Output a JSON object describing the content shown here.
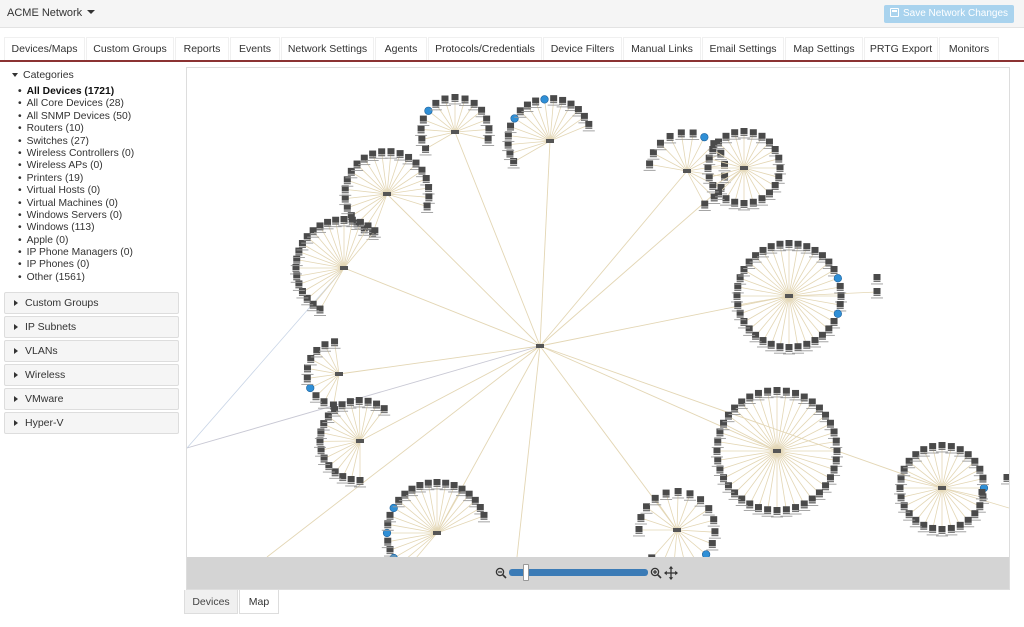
{
  "header": {
    "network_name": "ACME Network",
    "save_label": "Save Network Changes"
  },
  "tabs": [
    {
      "label": "Devices/Maps",
      "style": "active"
    },
    {
      "label": "Custom Groups",
      "style": "pink"
    },
    {
      "label": "Reports",
      "style": "pink"
    },
    {
      "label": "Events",
      "style": "pink"
    },
    {
      "label": "Network Settings",
      "style": "teal"
    },
    {
      "label": "Agents",
      "style": "teal"
    },
    {
      "label": "Protocols/Credentials",
      "style": "teal"
    },
    {
      "label": "Device Filters",
      "style": "teal"
    },
    {
      "label": "Manual Links",
      "style": "teal"
    },
    {
      "label": "Email Settings",
      "style": "teal"
    },
    {
      "label": "Map Settings",
      "style": "teal"
    },
    {
      "label": "PRTG Export",
      "style": "teal"
    },
    {
      "label": "Monitors",
      "style": "peach"
    }
  ],
  "sidebar": {
    "categories_title": "Categories",
    "categories": [
      "All Devices (1721)",
      "All Core Devices (28)",
      "All SNMP Devices (50)",
      "Routers (10)",
      "Switches (27)",
      "Wireless Controllers (0)",
      "Wireless APs (0)",
      "Printers (19)",
      "Virtual Hosts (0)",
      "Virtual Machines (0)",
      "Windows Servers (0)",
      "Windows (113)",
      "Apple (0)",
      "IP Phone Managers (0)",
      "IP Phones (0)",
      "Other (1561)"
    ],
    "selected_category": "All Devices (1721)",
    "sections": [
      "Custom Groups",
      "IP Subnets",
      "VLANs",
      "Wireless",
      "VMware",
      "Hyper-V"
    ]
  },
  "view_tabs": {
    "devices": "Devices",
    "map": "Map",
    "active": "Map"
  },
  "map": {
    "zoom_level_fraction": 0.12
  },
  "colors": {
    "active_tab": "#8b3232",
    "pink_tab": "#f4d8d8",
    "teal_tab": "#bfe0e0",
    "peach_tab": "#f6e3d4",
    "save_button": "#a9d3ee",
    "link_line": "#e3d6b4",
    "zoom_track": "#3b7bb6"
  },
  "icons": {
    "dropdown": "caret-down-icon",
    "save": "floppy-disk-icon",
    "collapse": "triangle-down-icon",
    "expand": "triangle-right-icon",
    "zoom_out": "zoom-out-icon",
    "zoom_in": "zoom-in-icon",
    "pan": "pan-arrows-icon",
    "device": "device-icon",
    "windows": "windows-globe-icon"
  }
}
